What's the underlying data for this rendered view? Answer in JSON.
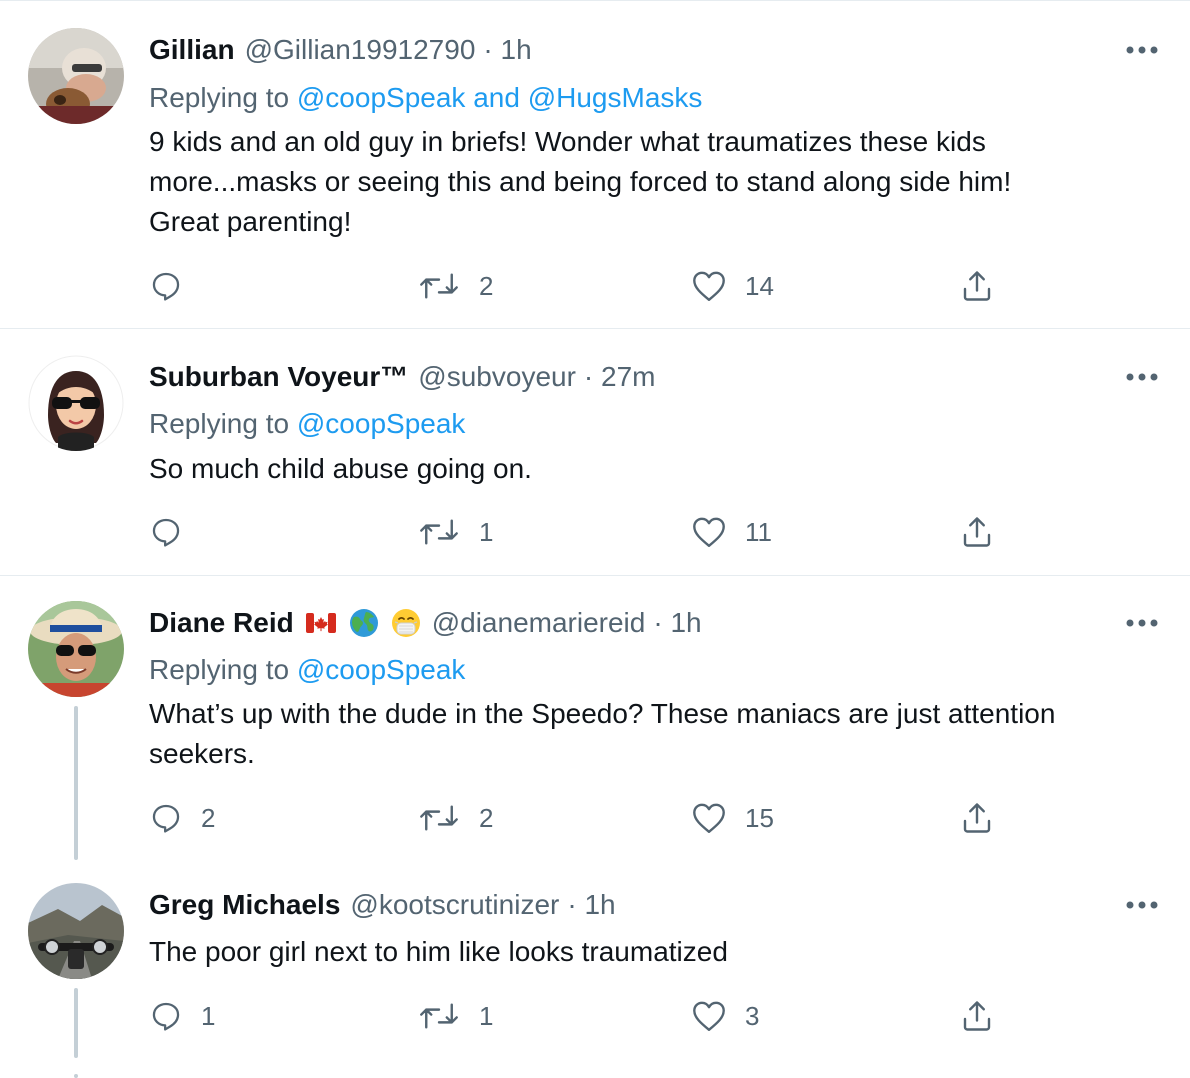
{
  "tweets": [
    {
      "name": "Gillian",
      "handle": "@Gillian19912790",
      "time": "· 1h",
      "replying_prefix": "Replying to ",
      "replying_to_1": "@coopSpeak",
      "replying_joiner": " and ",
      "replying_to_2": "@HugsMasks",
      "body_lines": [
        "9 kids and an old guy in briefs!  Wonder what traumatizes these kids",
        "more...masks or seeing this and being forced to stand along side him!",
        "Great parenting!"
      ],
      "reply_count": "",
      "retweet_count": "2",
      "like_count": "14"
    },
    {
      "name": "Suburban Voyeur™",
      "handle": "@subvoyeur",
      "time": "· 27m",
      "replying_prefix": "Replying to ",
      "replying_to_1": "@coopSpeak",
      "body_lines": [
        "So much child abuse going on."
      ],
      "reply_count": "",
      "retweet_count": "1",
      "like_count": "11"
    },
    {
      "name": "Diane Reid",
      "emojis": [
        "canada-flag-icon",
        "globe-icon",
        "mask-face-icon"
      ],
      "handle": "@dianemariereid",
      "time": "· 1h",
      "replying_prefix": "Replying to ",
      "replying_to_1": "@coopSpeak",
      "body_lines": [
        "What’s up with the dude in the Speedo? These maniacs are just attention",
        "seekers."
      ],
      "reply_count": "2",
      "retweet_count": "2",
      "like_count": "15"
    },
    {
      "name": "Greg Michaels",
      "handle": "@kootscrutinizer",
      "time": "· 1h",
      "body_lines": [
        "The poor girl next to him like looks traumatized"
      ],
      "reply_count": "1",
      "retweet_count": "1",
      "like_count": "3"
    }
  ],
  "colors": {
    "text": "#0f1419",
    "secondary": "#536471",
    "link": "#1d9bf0",
    "divider": "#e6ecf0",
    "thread_line": "#c4cfd6"
  }
}
